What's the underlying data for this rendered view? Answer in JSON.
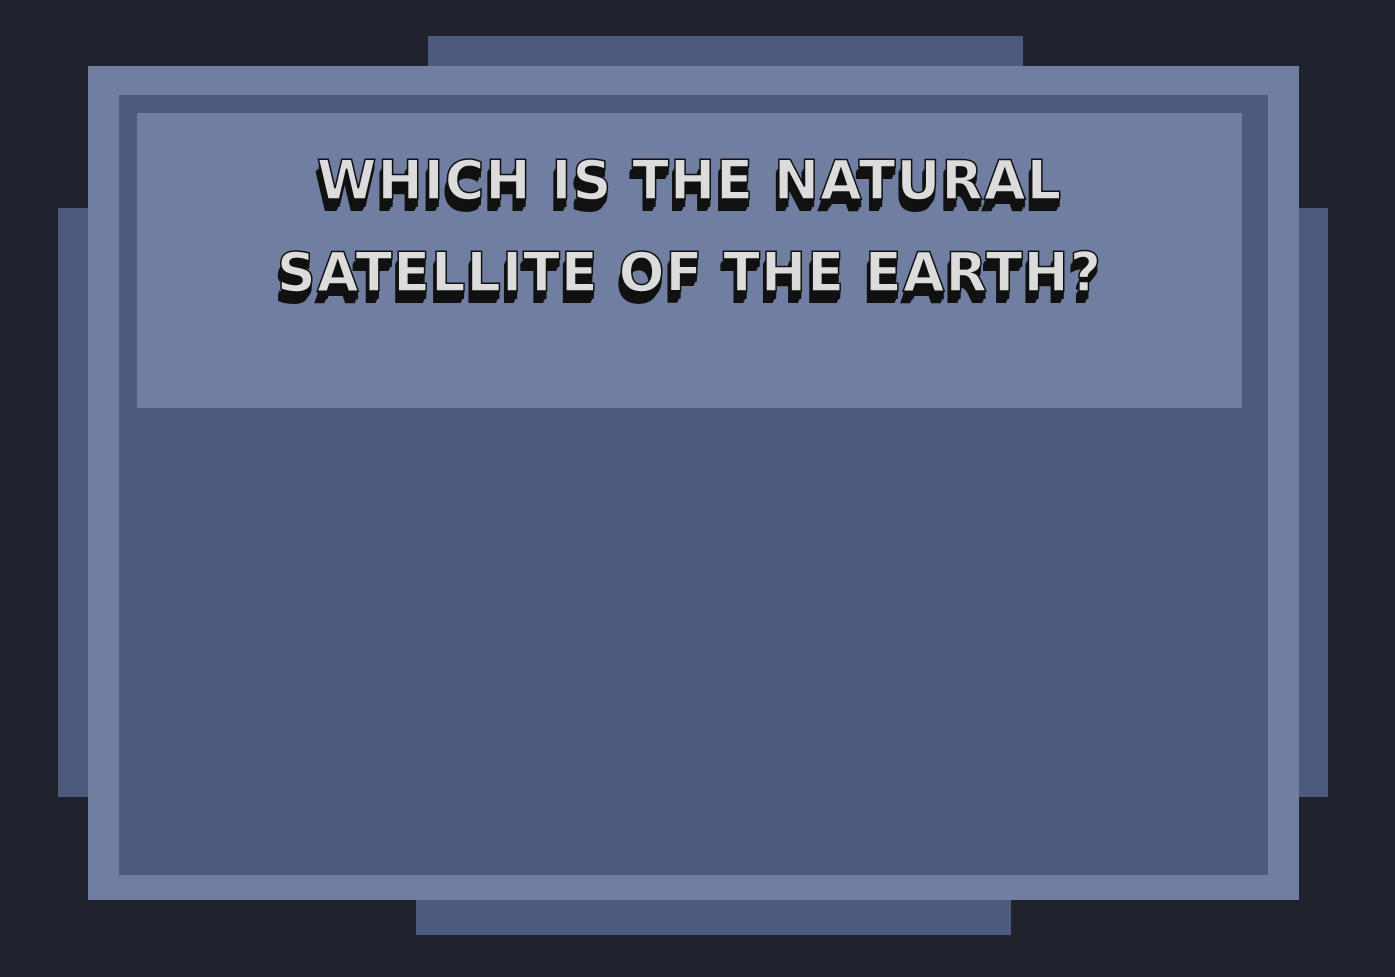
{
  "question": {
    "line1": "WHICH IS THE NATURAL",
    "line2": "SATELLITE OF THE EARTH?"
  },
  "colors": {
    "background": "#20232e",
    "frame_light": "#6f7ea1",
    "frame_dark": "#4c5b7d",
    "text_fill": "#dcdcdc",
    "text_shadow": "#111111"
  }
}
